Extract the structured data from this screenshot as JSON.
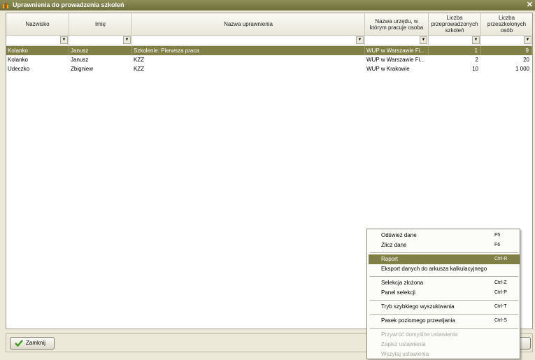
{
  "window": {
    "title": "Uprawnienia do prowadzenia szkoleń",
    "close_glyph": "✕"
  },
  "grid": {
    "columns": [
      {
        "label": "Nazwisko"
      },
      {
        "label": "Imię"
      },
      {
        "label": "Nazwa uprawnienia"
      },
      {
        "label": "Nazwa urzędu, w którym pracuje osoba"
      },
      {
        "label": "Liczba przeprowadzonych szkoleń"
      },
      {
        "label": "Liczba przeszkolonych osób"
      }
    ],
    "filter_glyph": "▼",
    "rows": [
      {
        "nazwisko": "Kolanko",
        "imie": "Janusz",
        "uprawnienie": "Szkolenie: Pierwsza praca",
        "urzad": "WUP w Warszawie Fi...",
        "szkolenia": "1",
        "osoby": "9",
        "selected": true
      },
      {
        "nazwisko": "Kolanko",
        "imie": "Janusz",
        "uprawnienie": "KZZ",
        "urzad": "WUP w Warszawie Fi...",
        "szkolenia": "2",
        "osoby": "20",
        "selected": false
      },
      {
        "nazwisko": "Udeczko",
        "imie": "Zbigniew",
        "uprawnienie": "KZZ",
        "urzad": "WUP w Krakowie",
        "szkolenia": "10",
        "osoby": "1 000",
        "selected": false
      }
    ]
  },
  "buttons": {
    "close_label": "Zamknij"
  },
  "context_menu": {
    "items": [
      {
        "label": "Odśwież dane",
        "shortcut": "F5"
      },
      {
        "label": "Zlicz dane",
        "shortcut": "F6"
      },
      {
        "label": "Raport",
        "shortcut": "Ctrl-R"
      },
      {
        "label": "Eksport danych do arkusza kalkulacyjnego",
        "shortcut": ""
      },
      {
        "label": "Selekcja złożona",
        "shortcut": "Ctrl-Z"
      },
      {
        "label": "Panel selekcji",
        "shortcut": "Ctrl-P"
      },
      {
        "label": "Tryb szybkiego wyszukiwania",
        "shortcut": "Ctrl-T"
      },
      {
        "label": "Pasek poziomego przewijania",
        "shortcut": "Ctrl-S"
      },
      {
        "label": "Przywróć domyślne ustawienia",
        "shortcut": ""
      },
      {
        "label": "Zapisz ustawienia",
        "shortcut": ""
      },
      {
        "label": "Wczytaj ustawienia",
        "shortcut": ""
      }
    ]
  },
  "colors": {
    "selection": "#7f7f46",
    "titlebar": "#7e7f4a"
  }
}
